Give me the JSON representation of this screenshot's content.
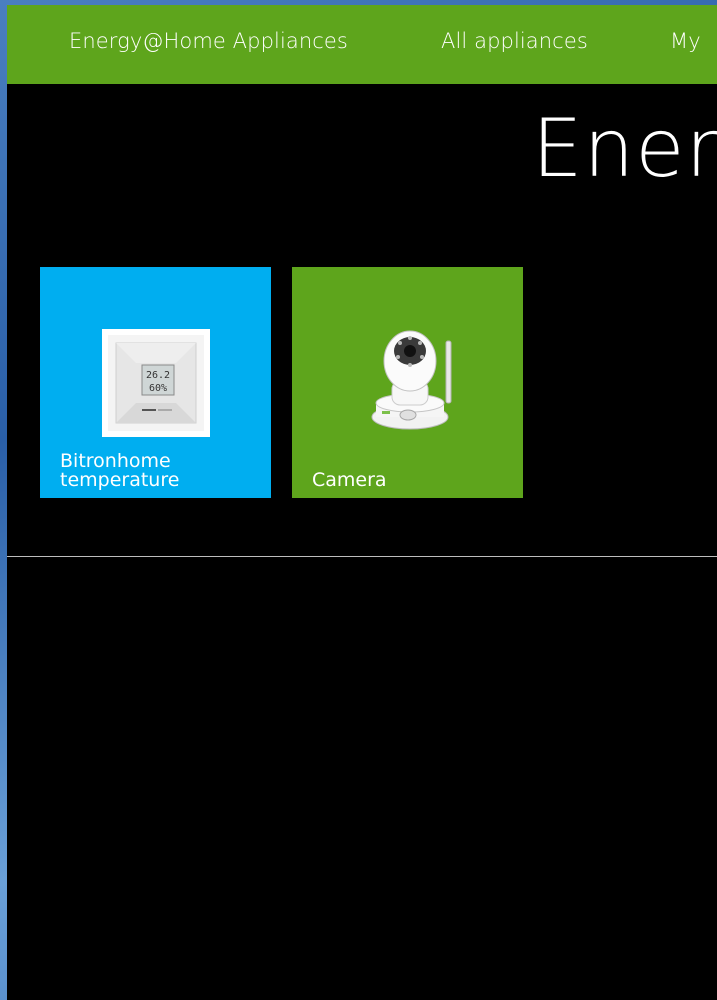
{
  "nav": {
    "brand": "Energy@Home Appliances",
    "all_appliances": "All appliances",
    "my": "My"
  },
  "page": {
    "title": "Ener"
  },
  "tiles": [
    {
      "label_line1": "Bitronhome",
      "label_line2": "temperature",
      "icon": "thermostat-sensor-icon",
      "color": "#00aef0",
      "device_display_top": "26.2",
      "device_display_bottom": "60%"
    },
    {
      "label_line1": "Camera",
      "icon": "ip-camera-icon",
      "color": "#5ea51c"
    }
  ],
  "colors": {
    "nav_bg": "#5ea51c",
    "app_bg": "#000000",
    "accent_blue": "#00aef0",
    "accent_green": "#5ea51c"
  }
}
